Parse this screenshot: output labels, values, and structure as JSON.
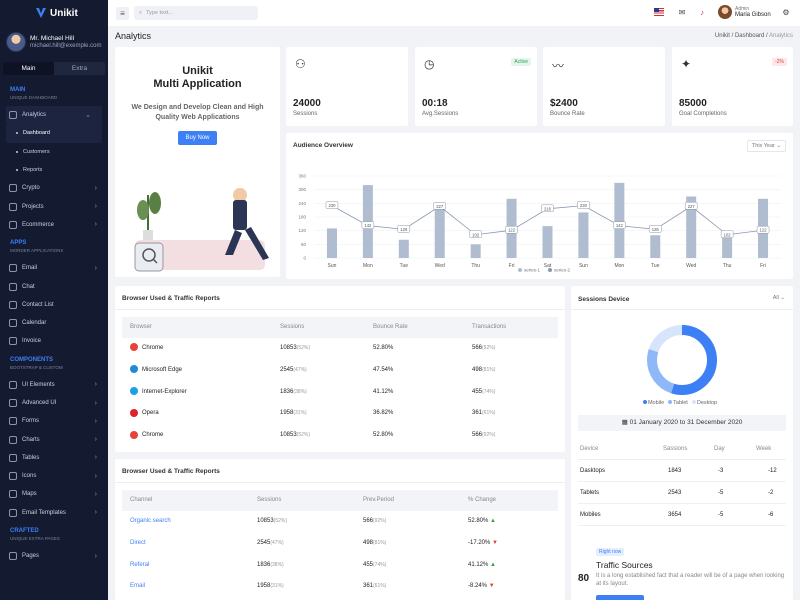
{
  "app": {
    "name": "Unikit"
  },
  "user": {
    "name": "Mr. Michael Hill",
    "email": "michael.hill@exemple.com"
  },
  "sidebar": {
    "tabs": [
      "Main",
      "Extra"
    ],
    "sections": {
      "main": {
        "title": "MAIN",
        "subtitle": "UNIQUE DASHBOARD"
      },
      "apps": {
        "title": "APPS",
        "subtitle": "MORDER APPLICATIONS"
      },
      "components": {
        "title": "COMPONENTS",
        "subtitle": "BOOTSTRAP & CUSTOM"
      },
      "crafted": {
        "title": "CRAFTED",
        "subtitle": "UNIQUE EXTRA PAGES"
      }
    },
    "main_items": [
      "Analytics",
      "Crypto",
      "Projects",
      "Ecommerce"
    ],
    "analytics_sub": [
      "Dashboard",
      "Customers",
      "Reports"
    ],
    "apps_items": [
      "Email",
      "Chat",
      "Contact List",
      "Calendar",
      "Invoice"
    ],
    "component_items": [
      "UI Elements",
      "Advanced UI",
      "Forms",
      "Charts",
      "Tables",
      "Icons",
      "Maps",
      "Email Templates"
    ],
    "crafted_items": [
      "Pages"
    ]
  },
  "topbar": {
    "search_placeholder": "Type text...",
    "role": "Admin",
    "username": "Maria Gibson"
  },
  "page": {
    "title": "Analytics",
    "breadcrumb": [
      "Unikit",
      "Dashboard",
      "Analytics"
    ]
  },
  "welcome": {
    "title1": "Unikit",
    "title2": "Multi Application",
    "text": "We Design and Develop Clean and High Quality Web Applications",
    "button": "Buy Now"
  },
  "stats": [
    {
      "value": "24000",
      "label": "Sessions",
      "icon": "users-icon"
    },
    {
      "value": "00:18",
      "label": "Avg.Sessions",
      "badge": "Active",
      "icon": "clock-icon"
    },
    {
      "value": "$2400",
      "label": "Bounce Rate",
      "icon": "activity-icon"
    },
    {
      "value": "85000",
      "label": "Goal Completions",
      "badge": "-2%",
      "icon": "confetti-icon"
    }
  ],
  "audience": {
    "title": "Audience Overview",
    "filter": "This Year"
  },
  "chart_data": {
    "type": "bar",
    "categories": [
      "Sun",
      "Mon",
      "Tue",
      "Wed",
      "Thu",
      "Fri",
      "Sat",
      "Sun",
      "Mon",
      "Tue",
      "Wed",
      "Thu",
      "Fri"
    ],
    "series": [
      {
        "name": "series-1",
        "values": [
          130,
          320,
          80,
          227,
          60,
          260,
          140,
          200,
          330,
          100,
          270,
          100,
          260
        ]
      },
      {
        "name": "series-2",
        "values": [
          230,
          142,
          126,
          227,
          102,
          122,
          216,
          230,
          142,
          126,
          227,
          102,
          122
        ]
      }
    ],
    "yticks": [
      "360",
      "300",
      "240",
      "180",
      "120",
      "60",
      "0"
    ],
    "ylim": [
      0,
      360
    ]
  },
  "browser_table": {
    "title": "Browser Used & Traffic Reports",
    "columns": [
      "Browser",
      "Sessions",
      "Bounce Rate",
      "Transactions"
    ],
    "rows": [
      {
        "name": "Chrome",
        "sessions": "10853",
        "sp": "(52%)",
        "bounce": "52.80%",
        "trans": "566",
        "tp": "(92%)",
        "color": "#e9423a"
      },
      {
        "name": "Microsoft Edge",
        "sessions": "2545",
        "sp": "(47%)",
        "bounce": "47.54%",
        "trans": "498",
        "tp": "(81%)",
        "color": "#1f8ad9"
      },
      {
        "name": "Internet-Explorer",
        "sessions": "1836",
        "sp": "(38%)",
        "bounce": "41.12%",
        "trans": "455",
        "tp": "(74%)",
        "color": "#1aa0e6"
      },
      {
        "name": "Opera",
        "sessions": "1958",
        "sp": "(31%)",
        "bounce": "36.82%",
        "trans": "361",
        "tp": "(61%)",
        "color": "#e0202b"
      },
      {
        "name": "Chrome",
        "sessions": "10853",
        "sp": "(52%)",
        "bounce": "52.80%",
        "trans": "566",
        "tp": "(92%)",
        "color": "#e9423a"
      }
    ]
  },
  "channel_table": {
    "title": "Browser Used & Traffic Reports",
    "columns": [
      "Channel",
      "Sessions",
      "Prev.Period",
      "% Change"
    ],
    "rows": [
      {
        "name": "Organic search",
        "sessions": "10853",
        "sp": "(52%)",
        "prev": "566",
        "pp": "(92%)",
        "change": "52.80%",
        "up": true
      },
      {
        "name": "Direct",
        "sessions": "2545",
        "sp": "(47%)",
        "prev": "498",
        "pp": "(81%)",
        "change": "-17.20%",
        "up": false
      },
      {
        "name": "Referal",
        "sessions": "1836",
        "sp": "(38%)",
        "prev": "455",
        "pp": "(74%)",
        "change": "41.12%",
        "up": true
      },
      {
        "name": "Email",
        "sessions": "1958",
        "sp": "(31%)",
        "prev": "361",
        "pp": "(61%)",
        "change": "-8.24%",
        "up": false
      }
    ]
  },
  "sessions_device": {
    "title": "Sessions Device",
    "filter": "All",
    "legend": [
      "Mobile",
      "Tablet",
      "Desktop"
    ],
    "colors": [
      "#3d7ff5",
      "#8fb8f8",
      "#d6e5fc"
    ],
    "date_range": "01 January 2020 to 31 December 2020",
    "columns": [
      "Device",
      "Sassions",
      "Day",
      "Week"
    ],
    "rows": [
      {
        "device": "Dasktops",
        "sessions": "1843",
        "day": "-3",
        "week": "-12"
      },
      {
        "device": "Tablets",
        "sessions": "2543",
        "day": "-5",
        "week": "-2"
      },
      {
        "device": "Mobiles",
        "sessions": "3654",
        "day": "-5",
        "week": "-6"
      }
    ],
    "donut_values": [
      55,
      25,
      20
    ]
  },
  "traffic": {
    "badge": "Right now",
    "number": "80",
    "title": "Traffic Sources",
    "text": "It is a long established fact that a reader will be of a page when looking at its layout."
  }
}
